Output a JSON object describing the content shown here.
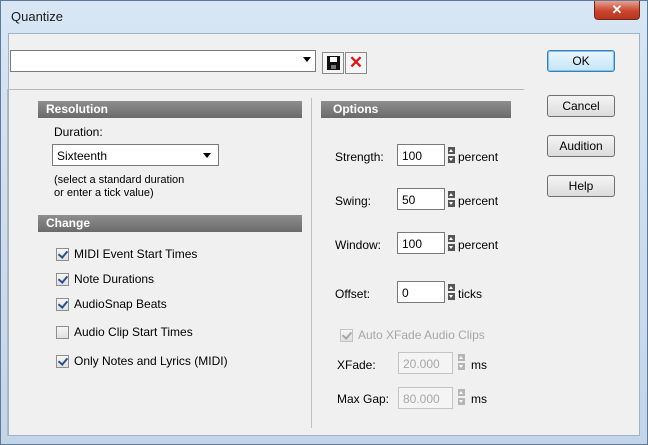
{
  "window": {
    "title": "Quantize"
  },
  "preset": {
    "value": ""
  },
  "resolution": {
    "header": "Resolution",
    "duration_label": "Duration:",
    "duration_value": "Sixteenth",
    "hint_line1": "(select a standard duration",
    "hint_line2": "or enter a tick value)"
  },
  "change": {
    "header": "Change",
    "items": [
      {
        "label": "MIDI Event Start Times",
        "checked": true
      },
      {
        "label": "Note Durations",
        "checked": true
      },
      {
        "label": "AudioSnap Beats",
        "checked": true
      },
      {
        "label": "Audio Clip Start Times",
        "checked": false
      },
      {
        "label": "Only Notes and Lyrics (MIDI)",
        "checked": true
      }
    ]
  },
  "options": {
    "header": "Options",
    "strength": {
      "label": "Strength:",
      "value": "100",
      "unit": "percent"
    },
    "swing": {
      "label": "Swing:",
      "value": "50",
      "unit": "percent"
    },
    "window": {
      "label": "Window:",
      "value": "100",
      "unit": "percent"
    },
    "offset": {
      "label": "Offset:",
      "value": "0",
      "unit": "ticks"
    },
    "auto_xfade": {
      "label": "Auto XFade Audio Clips",
      "checked": true,
      "enabled": false
    },
    "xfade": {
      "label": "XFade:",
      "value": "20.000",
      "unit": "ms"
    },
    "max_gap": {
      "label": "Max Gap:",
      "value": "80.000",
      "unit": "ms"
    }
  },
  "buttons": {
    "ok": "OK",
    "cancel": "Cancel",
    "audition": "Audition",
    "help": "Help"
  },
  "colors": {
    "accent": "#3c7fb1",
    "header_bg": "#7a7a7a",
    "close_red": "#c8462e"
  }
}
